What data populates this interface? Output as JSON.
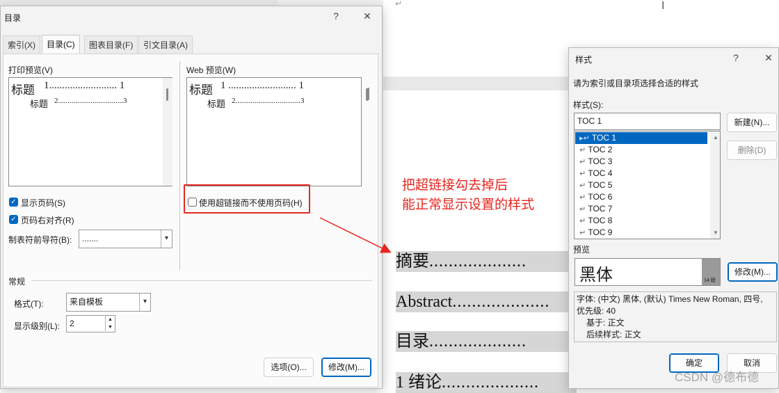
{
  "document": {
    "lines": [
      {
        "text": "摘要",
        "dots": "...................."
      },
      {
        "text": "Abstract",
        "dots": "...................."
      },
      {
        "text": "目录",
        "dots": "...................."
      },
      {
        "text": "1 绪论",
        "dots": "...................."
      }
    ],
    "paragraph_mark": "↵",
    "ibeam": "I"
  },
  "annotation": {
    "line1": "把超链接勾去掉后",
    "line2": "能正常显示设置的样式",
    "color": "#e6261f"
  },
  "toc_dialog": {
    "title": "目录",
    "help": "?",
    "close": "✕",
    "tabs": [
      "索引(X)",
      "目录(C)",
      "图表目录(F)",
      "引文目录(A)"
    ],
    "print_preview": {
      "label": "打印预览(V)",
      "heading1": "标题",
      "heading1_entry": "1.......................... 1",
      "heading2": "标题",
      "heading2_entry": "2..................................3"
    },
    "web_preview": {
      "label": "Web 预览(W)",
      "heading1": "标题",
      "heading1_entry": "1 .......................... 1",
      "heading2": "标题",
      "heading2_entry": "2..................................3"
    },
    "show_page_numbers": "显示页码(S)",
    "right_align": "页码右对齐(R)",
    "tab_leader_label": "制表符前导符(B):",
    "tab_leader_value": ".......",
    "use_hyperlinks": "使用超链接而不使用页码(H)",
    "general_label": "常规",
    "format_label": "格式(T):",
    "format_value": "来自模板",
    "levels_label": "显示级别(L):",
    "levels_value": "2",
    "options_button": "选项(O)...",
    "modify_button": "修改(M)..."
  },
  "style_dialog": {
    "title": "样式",
    "help": "?",
    "close": "✕",
    "instruction": "请为索引或目录项选择合适的样式",
    "styles_label": "样式(S):",
    "style_input": "TOC 1",
    "new_button": "新建(N)...",
    "delete_button": "删除(D)",
    "styles": [
      "TOC 1",
      "TOC 2",
      "TOC 3",
      "TOC 4",
      "TOC 5",
      "TOC 6",
      "TOC 7",
      "TOC 8",
      "TOC 9"
    ],
    "preview_label": "预览",
    "preview_text": "黑体",
    "preview_size": "14 磅",
    "modify_button": "修改(M)...",
    "description_line1": "字体: (中文) 黑体, (默认) Times New Roman, 四号,",
    "description_line2": "优先级: 40",
    "description_line3": "基于: 正文",
    "description_line4": "后续样式: 正文",
    "ok_button": "确定",
    "cancel_button": "取消"
  },
  "watermark": "CSDN @德布德"
}
